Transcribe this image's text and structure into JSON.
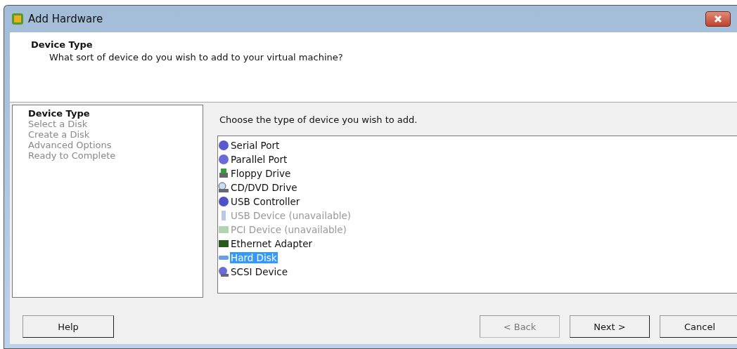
{
  "window": {
    "title": "Add Hardware"
  },
  "header": {
    "title": "Device Type",
    "subtitle": "What sort of device do you wish to add to your virtual machine?"
  },
  "steps": [
    {
      "label": "Device Type",
      "selected": true
    },
    {
      "label": "Select a Disk",
      "selected": false
    },
    {
      "label": "Create a Disk",
      "selected": false
    },
    {
      "label": "Advanced Options",
      "selected": false
    },
    {
      "label": "Ready to Complete",
      "selected": false
    }
  ],
  "prompt": "Choose the type of device you wish to add.",
  "devices": [
    {
      "label": "Serial Port",
      "disabled": false,
      "selected": false
    },
    {
      "label": "Parallel Port",
      "disabled": false,
      "selected": false
    },
    {
      "label": "Floppy Drive",
      "disabled": false,
      "selected": false
    },
    {
      "label": "CD/DVD Drive",
      "disabled": false,
      "selected": false
    },
    {
      "label": "USB Controller",
      "disabled": false,
      "selected": false
    },
    {
      "label": "USB Device (unavailable)",
      "disabled": true,
      "selected": false
    },
    {
      "label": "PCI Device (unavailable)",
      "disabled": true,
      "selected": false
    },
    {
      "label": "Ethernet Adapter",
      "disabled": false,
      "selected": false
    },
    {
      "label": "Hard Disk",
      "disabled": false,
      "selected": true
    },
    {
      "label": "SCSI Device",
      "disabled": false,
      "selected": false
    }
  ],
  "buttons": {
    "help": {
      "label": "Help"
    },
    "back": {
      "label": "< Back",
      "disabled": true
    },
    "next": {
      "label": "Next >",
      "disabled": false
    },
    "cancel": {
      "label": "Cancel",
      "disabled": false
    }
  }
}
